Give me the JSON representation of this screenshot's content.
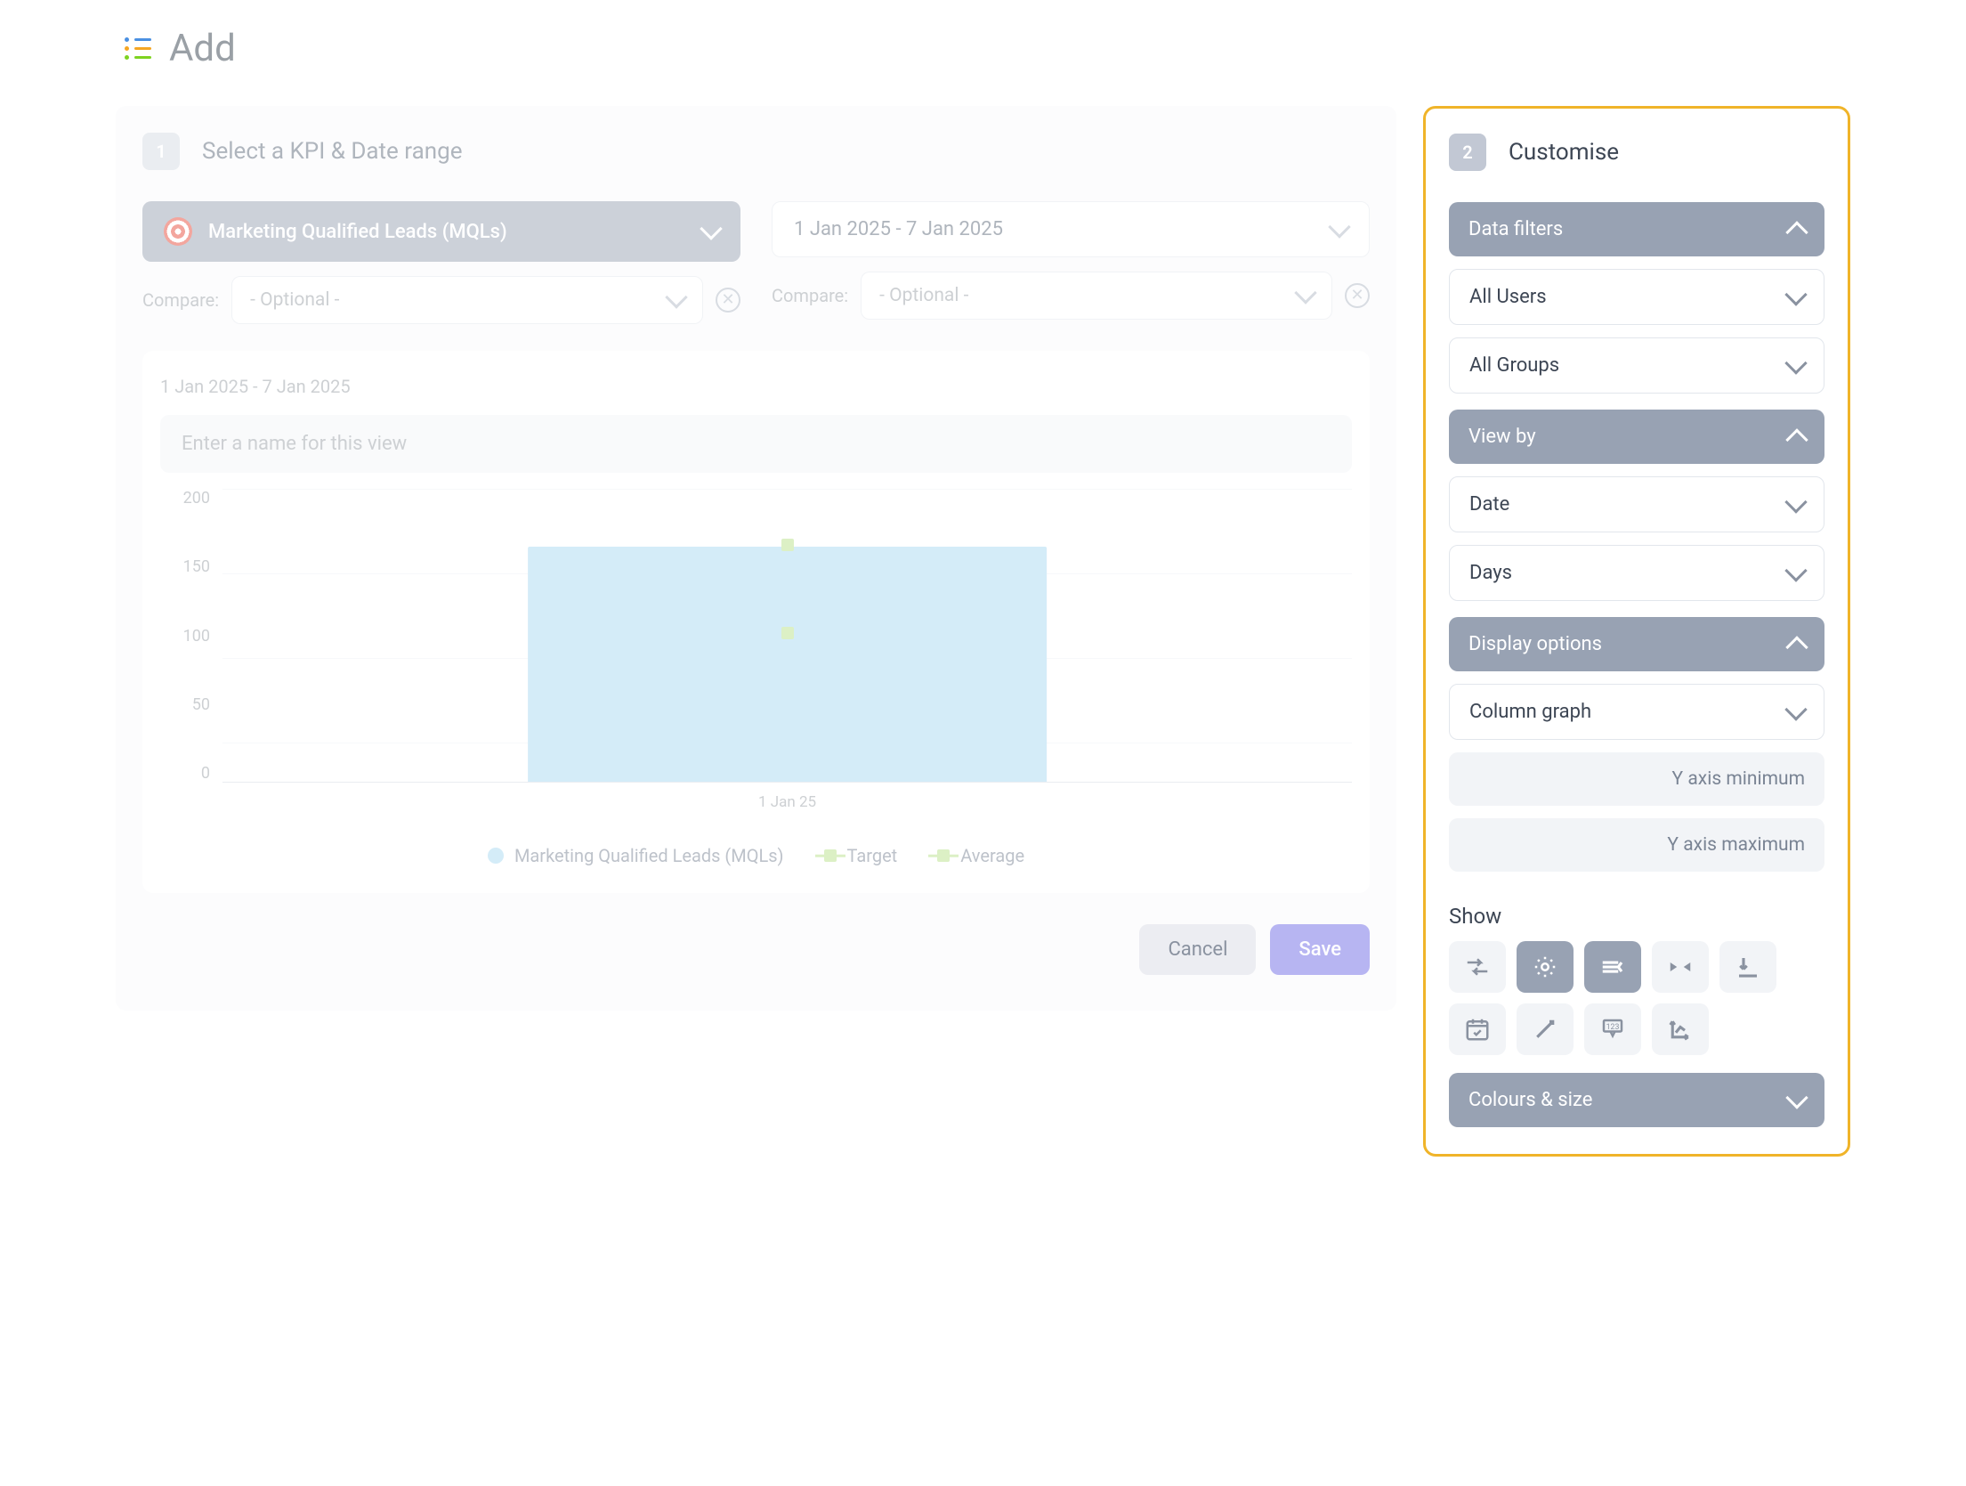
{
  "page": {
    "title": "Add"
  },
  "step1": {
    "badge": "1",
    "title": "Select a KPI & Date range",
    "kpi_label": "Marketing Qualified Leads (MQLs)",
    "date_range": "1 Jan 2025 - 7 Jan 2025",
    "compare_label": "Compare:",
    "compare_placeholder": "- Optional -"
  },
  "chart": {
    "date_range": "1 Jan 2025 - 7 Jan 2025",
    "name_placeholder": "Enter a name for this view",
    "y_ticks": [
      "200",
      "150",
      "100",
      "50",
      "0"
    ],
    "x_tick": "1 Jan 25",
    "legend": {
      "series": "Marketing Qualified Leads (MQLs)",
      "target": "Target",
      "average": "Average"
    }
  },
  "actions": {
    "cancel": "Cancel",
    "save": "Save"
  },
  "step2": {
    "badge": "2",
    "title": "Customise",
    "data_filters": {
      "header": "Data filters",
      "users": "All Users",
      "groups": "All Groups"
    },
    "view_by": {
      "header": "View by",
      "dimension": "Date",
      "granularity": "Days"
    },
    "display": {
      "header": "Display options",
      "chart_type": "Column graph",
      "ymin_placeholder": "Y axis minimum",
      "ymax_placeholder": "Y axis maximum",
      "show_label": "Show"
    },
    "colours": {
      "header": "Colours & size"
    }
  },
  "chart_data": {
    "type": "bar",
    "categories": [
      "1 Jan 25"
    ],
    "series": [
      {
        "name": "Marketing Qualified Leads (MQLs)",
        "values": [
          160
        ]
      },
      {
        "name": "Target",
        "values": [
          160
        ]
      },
      {
        "name": "Average",
        "values": [
          100
        ]
      }
    ],
    "title": "",
    "xlabel": "",
    "ylabel": "",
    "ylim": [
      0,
      200
    ]
  },
  "colors": {
    "bar": "#a8d8f0",
    "marker": "#b8e08a",
    "accent": "#98a2b3",
    "highlight_border": "#f0b429"
  }
}
